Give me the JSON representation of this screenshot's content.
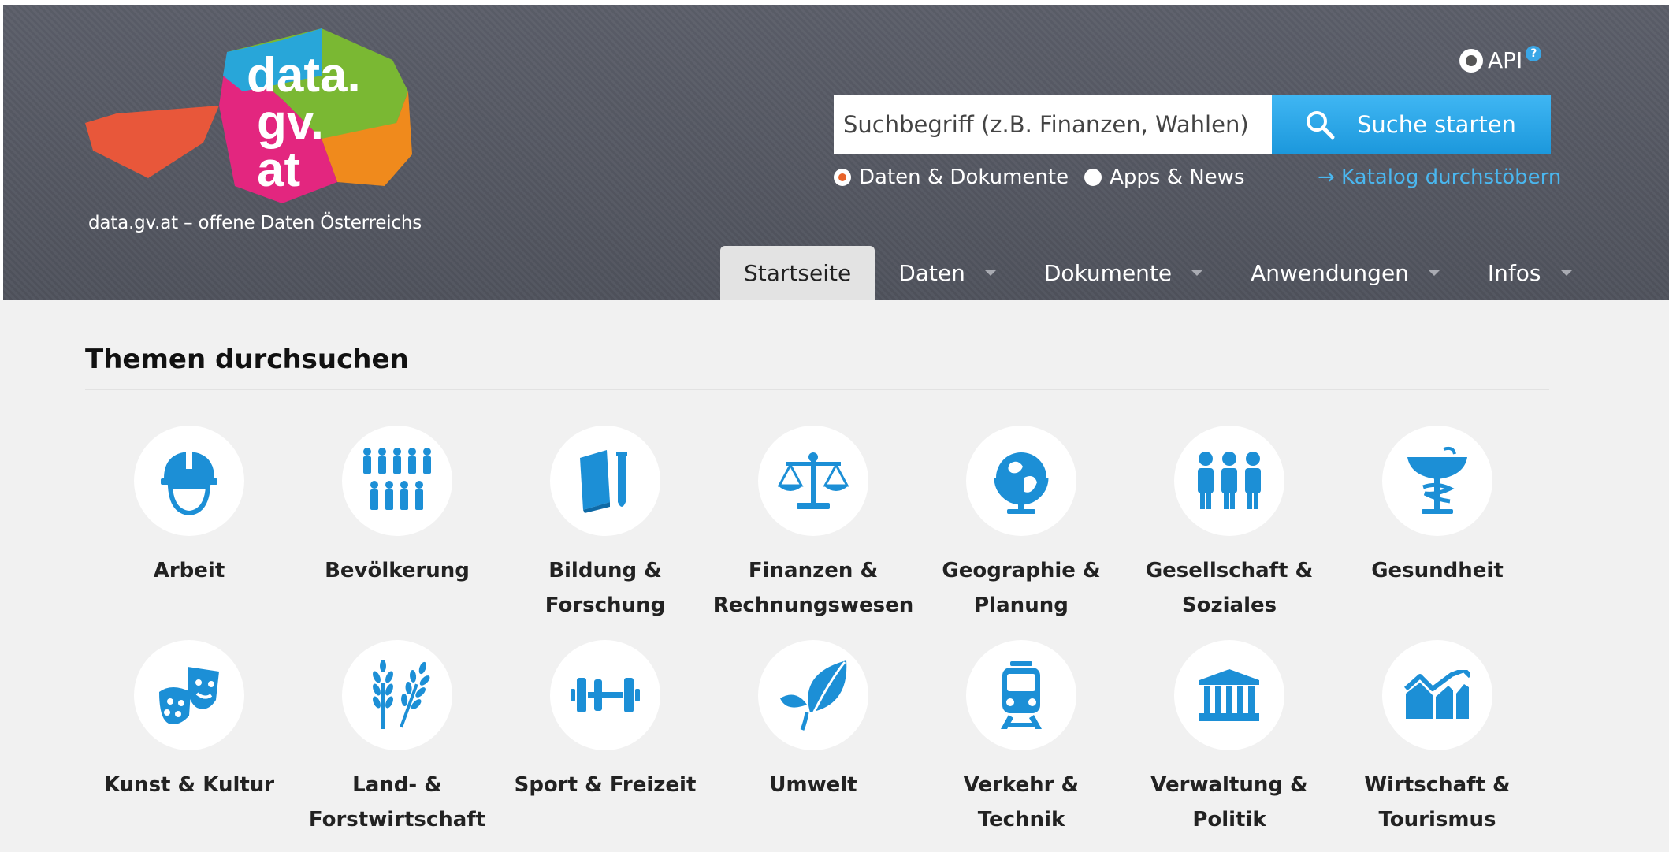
{
  "header": {
    "logo_text": [
      "data.",
      "gv.",
      "at"
    ],
    "tagline": "data.gv.at – offene Daten Österreichs",
    "api_label": "API",
    "api_help": "?"
  },
  "search": {
    "placeholder": "Suchbegriff (z.B. Finanzen, Wahlen)",
    "button_label": "Suche starten",
    "options": [
      {
        "label": "Daten & Dokumente",
        "checked": true
      },
      {
        "label": "Apps & News",
        "checked": false
      }
    ],
    "catalog_link": "→ Katalog durchstöbern"
  },
  "nav": {
    "items": [
      {
        "label": "Startseite",
        "active": true,
        "dropdown": false
      },
      {
        "label": "Daten",
        "active": false,
        "dropdown": true
      },
      {
        "label": "Dokumente",
        "active": false,
        "dropdown": true
      },
      {
        "label": "Anwendungen",
        "active": false,
        "dropdown": true
      },
      {
        "label": "Infos",
        "active": false,
        "dropdown": true
      }
    ]
  },
  "main": {
    "title": "Themen durchsuchen",
    "topics": [
      {
        "label": "Arbeit",
        "icon": "hardhat-icon"
      },
      {
        "label": "Bevölkerung",
        "icon": "population-icon"
      },
      {
        "label": "Bildung & Forschung",
        "icon": "education-icon"
      },
      {
        "label": "Finanzen & Rechnungswesen",
        "icon": "scales-icon"
      },
      {
        "label": "Geographie & Planung",
        "icon": "globe-icon"
      },
      {
        "label": "Gesellschaft & Soziales",
        "icon": "people-icon"
      },
      {
        "label": "Gesundheit",
        "icon": "health-icon"
      },
      {
        "label": "Kunst & Kultur",
        "icon": "theater-masks-icon"
      },
      {
        "label": "Land- & Forstwirtschaft",
        "icon": "wheat-icon"
      },
      {
        "label": "Sport & Freizeit",
        "icon": "dumbbell-icon"
      },
      {
        "label": "Umwelt",
        "icon": "leaf-icon"
      },
      {
        "label": "Verkehr & Technik",
        "icon": "train-icon"
      },
      {
        "label": "Verwaltung & Politik",
        "icon": "government-building-icon"
      },
      {
        "label": "Wirtschaft & Tourismus",
        "icon": "economy-chart-icon"
      }
    ]
  },
  "colors": {
    "accent_blue": "#1c8fd6",
    "header_gray": "#55585f",
    "radio_orange": "#e8632a"
  }
}
